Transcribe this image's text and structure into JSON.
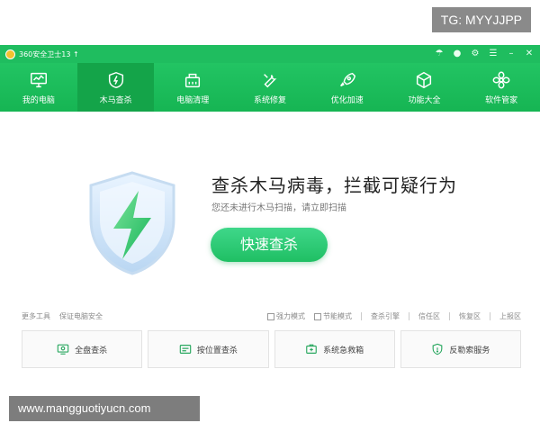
{
  "overlay": {
    "tg_label": "TG: MYYJJPP",
    "watermark": "www.mangguotiyucn.com"
  },
  "app": {
    "title": "360安全卫士13 ↑"
  },
  "window_controls": [
    "sync-icon",
    "avatar-icon",
    "skin-icon",
    "menu-icon",
    "minimize-icon",
    "close-icon"
  ],
  "nav": {
    "items": [
      {
        "label": "我的电脑",
        "icon": "monitor-icon"
      },
      {
        "label": "木马查杀",
        "icon": "shield-icon",
        "active": true
      },
      {
        "label": "电脑清理",
        "icon": "broom-icon"
      },
      {
        "label": "系统修复",
        "icon": "wrench-icon"
      },
      {
        "label": "优化加速",
        "icon": "rocket-icon"
      },
      {
        "label": "功能大全",
        "icon": "cube-icon"
      },
      {
        "label": "软件管家",
        "icon": "apps-icon"
      }
    ]
  },
  "hero": {
    "title": "查杀木马病毒，拦截可疑行为",
    "subtitle": "您还未进行木马扫描，请立即扫描",
    "scan_button": "快速查杀"
  },
  "tools": {
    "left": [
      "更多工具",
      "保证电脑安全"
    ],
    "checkboxes": [
      "强力模式",
      "节能模式"
    ],
    "links": [
      "查杀引擎",
      "信任区",
      "恢复区",
      "上报区"
    ]
  },
  "cards": [
    {
      "label": "全盘查杀",
      "icon": "monitor-scan-icon"
    },
    {
      "label": "按位置查杀",
      "icon": "folder-scan-icon"
    },
    {
      "label": "系统急救箱",
      "icon": "first-aid-icon"
    },
    {
      "label": "反勒索服务",
      "icon": "shield-lock-icon"
    }
  ],
  "colors": {
    "brand": "#1fbd5f",
    "active_tab": "#14a449"
  }
}
